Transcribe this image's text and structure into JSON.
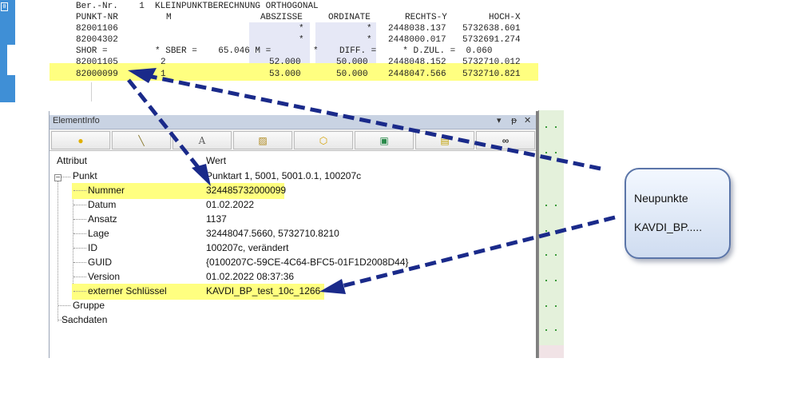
{
  "printout": {
    "line1": "Ber.-Nr.    1  KLEINPUNKTBERECHNUNG ORTHOGONAL",
    "header": {
      "punkt": "PUNKT-NR",
      "m": "M",
      "abszisse": "ABSZISSE",
      "ordinate": "ORDINATE",
      "rechts": "RECHTS-Y",
      "hoch": "HOCH-X"
    },
    "rows_a": [
      {
        "punkt": "82001106",
        "m": "",
        "abszisse": "*",
        "ordinate": "*",
        "rechts": "2448038.137",
        "hoch": "5732638.601"
      },
      {
        "punkt": "82004302",
        "m": "",
        "abszisse": "*",
        "ordinate": "*",
        "rechts": "2448000.017",
        "hoch": "5732691.274"
      }
    ],
    "shor_line": "SHOR =         * SBER =    65.046 M =        *    DIFF. =     * D.ZUL. =  0.060",
    "rows_b": [
      {
        "punkt": "82001105",
        "m": "2",
        "abszisse": "52.000",
        "ordinate": "50.000",
        "rechts": "2448048.152",
        "hoch": "5732710.012"
      },
      {
        "punkt": "82000099",
        "m": "1",
        "abszisse": "53.000",
        "ordinate": "50.000",
        "rechts": "2448047.566",
        "hoch": "5732710.821"
      }
    ]
  },
  "panel": {
    "title": "ElementInfo",
    "controls": {
      "dropdown": "▾",
      "pin": "ᵽ",
      "close": "✕"
    },
    "toolbar": [
      {
        "name": "point-tool-icon",
        "glyph": "●",
        "color": "#e0b000"
      },
      {
        "name": "line-tool-icon",
        "glyph": "╲",
        "color": "#8a7a30"
      },
      {
        "name": "text-tool-icon",
        "glyph": "A",
        "color": "#606060"
      },
      {
        "name": "hatch-tool-icon",
        "glyph": "▨",
        "color": "#b08a20"
      },
      {
        "name": "polygon-tool-icon",
        "glyph": "⬡",
        "color": "#d4a000"
      },
      {
        "name": "image-tool-icon",
        "glyph": "▣",
        "color": "#2a8a4a"
      },
      {
        "name": "note-tool-icon",
        "glyph": "▤",
        "color": "#c0a000"
      },
      {
        "name": "binoculars-icon",
        "glyph": "∞",
        "color": "#333333"
      }
    ],
    "col_attribut": "Attribut",
    "col_wert": "Wert",
    "punkt": {
      "label": "Punkt",
      "value": "Punktart 1, 5001, 5001.0.1, 100207c"
    },
    "children": [
      {
        "label": "Nummer",
        "value": "324485732000099"
      },
      {
        "label": "Datum",
        "value": "01.02.2022"
      },
      {
        "label": "Ansatz",
        "value": "1137"
      },
      {
        "label": "Lage",
        "value": "32448047.5660, 5732710.8210"
      },
      {
        "label": "ID",
        "value": "100207c, verändert"
      },
      {
        "label": "GUID",
        "value": "{0100207C-59CE-4C64-BFC5-01F1D2008D44}"
      },
      {
        "label": "Version",
        "value": "01.02.2022 08:37:36"
      },
      {
        "label": "externer Schlüssel",
        "value": "KAVDI_BP_test_10c_1266"
      }
    ],
    "gruppe": "Gruppe",
    "sachdaten": "Sachdaten"
  },
  "callout": {
    "line1": "Neupunkte",
    "line2": "KAVDI_BP....."
  },
  "colors": {
    "highlight": "#ffff80",
    "arrow": "#1a2a8a",
    "panel_title": "#c9d3e3",
    "map": "#e4f1db"
  }
}
